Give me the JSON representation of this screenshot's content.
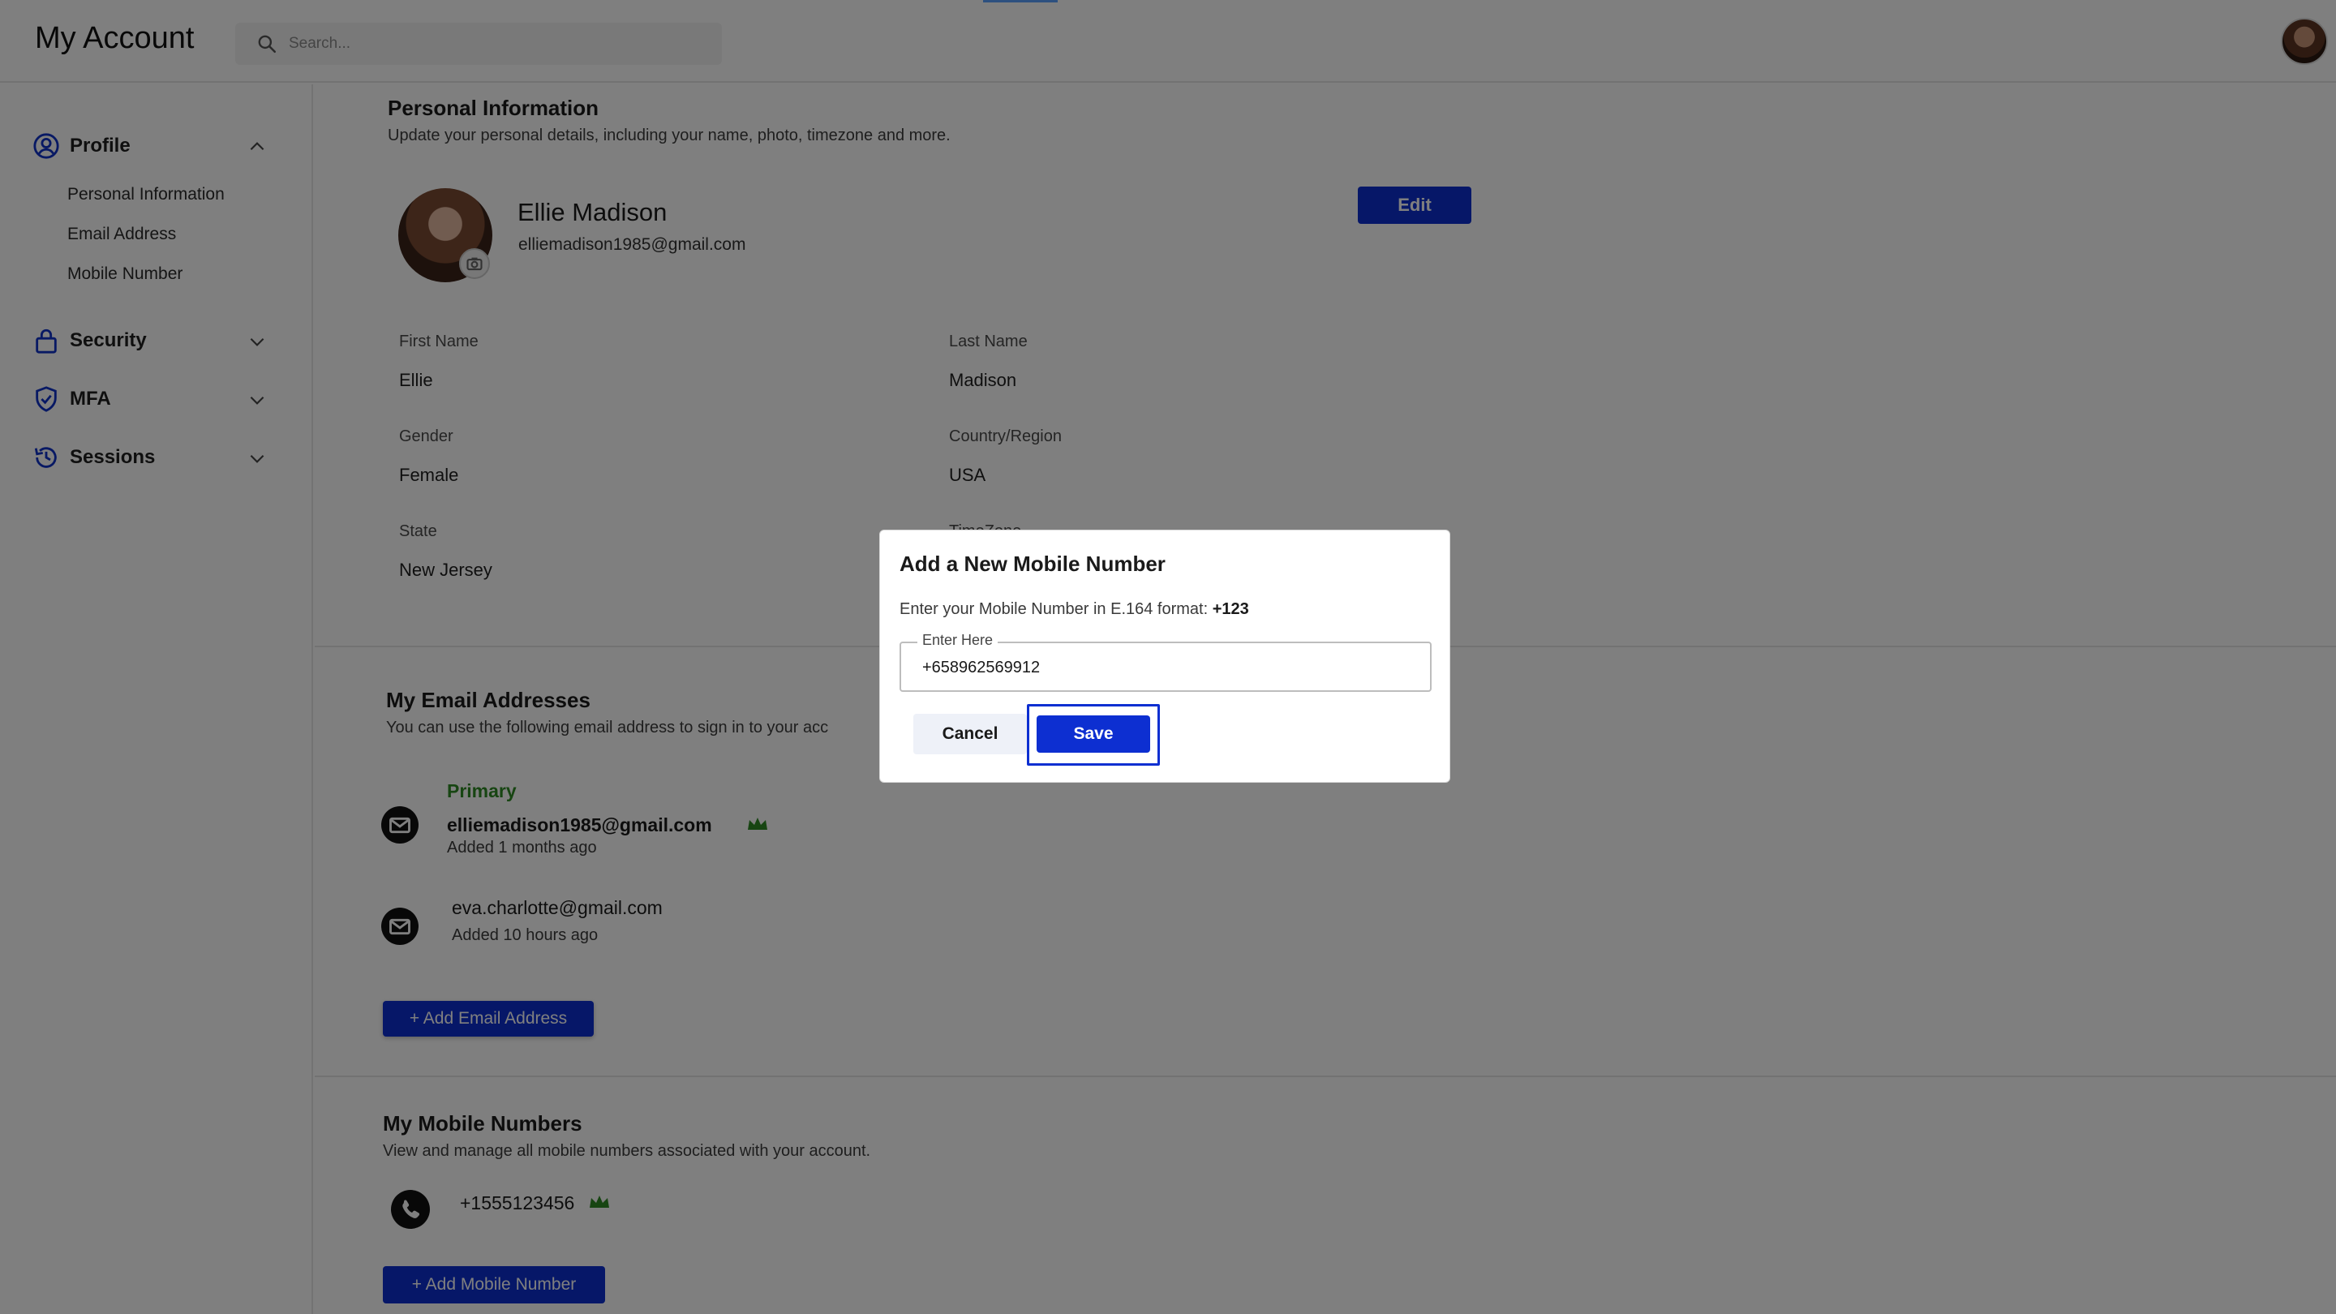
{
  "header": {
    "title": "My Account",
    "search_placeholder": "Search..."
  },
  "sidebar": {
    "groups": [
      {
        "label": "Profile",
        "icon": "user-circle-icon",
        "expanded": true
      },
      {
        "label": "Security",
        "icon": "lock-icon",
        "expanded": false
      },
      {
        "label": "MFA",
        "icon": "shield-check-icon",
        "expanded": false
      },
      {
        "label": "Sessions",
        "icon": "history-icon",
        "expanded": false
      }
    ],
    "profile_items": [
      "Personal Information",
      "Email Address",
      "Mobile Number"
    ]
  },
  "personal_info": {
    "title": "Personal Information",
    "subtitle": "Update your personal details, including your name, photo, timezone and more.",
    "name": "Ellie Madison",
    "email": "elliemadison1985@gmail.com",
    "edit_label": "Edit",
    "fields": {
      "first_name": {
        "label": "First Name",
        "value": "Ellie"
      },
      "last_name": {
        "label": "Last Name",
        "value": "Madison"
      },
      "gender": {
        "label": "Gender",
        "value": "Female"
      },
      "country": {
        "label": "Country/Region",
        "value": "USA"
      },
      "state": {
        "label": "State",
        "value": "New Jersey"
      },
      "timezone": {
        "label": "TimeZone"
      }
    }
  },
  "emails": {
    "title": "My Email Addresses",
    "subtitle": "You can use the following email address to sign in to your acc",
    "primary_tag": "Primary",
    "items": [
      {
        "email": "elliemadison1985@gmail.com",
        "added": "Added 1 months ago",
        "primary": true
      },
      {
        "email": "eva.charlotte@gmail.com",
        "added": "Added 10 hours ago",
        "primary": false
      }
    ],
    "add_label": "+ Add Email Address"
  },
  "mobiles": {
    "title": "My Mobile Numbers",
    "subtitle": "View and manage all mobile numbers associated with your account.",
    "items": [
      {
        "number": "+1555123456",
        "primary": true
      }
    ],
    "add_label": "+ Add Mobile Number"
  },
  "modal": {
    "title": "Add a New Mobile Number",
    "description": "Enter your Mobile Number in E.164 format: ",
    "format_example": "+123",
    "field_label": "Enter Here",
    "field_value": "+658962569912",
    "cancel_label": "Cancel",
    "save_label": "Save"
  },
  "colors": {
    "primary_button": "#0d2fd1",
    "primary_tag": "#2f8a24",
    "crown": "#2f8a24",
    "overlay": "rgba(0,0,0,0.5)"
  }
}
